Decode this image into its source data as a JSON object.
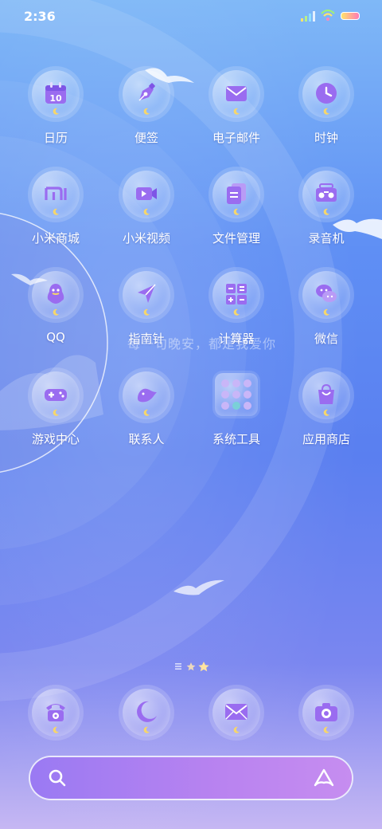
{
  "status": {
    "time": "2:36"
  },
  "apps": [
    {
      "label": "日历",
      "icon": "calendar-icon",
      "calendar_day": "10"
    },
    {
      "label": "便签",
      "icon": "pen-nib-icon"
    },
    {
      "label": "电子邮件",
      "icon": "mail-icon"
    },
    {
      "label": "时钟",
      "icon": "clock-icon"
    },
    {
      "label": "小米商城",
      "icon": "mi-logo-icon"
    },
    {
      "label": "小米视频",
      "icon": "video-icon"
    },
    {
      "label": "文件管理",
      "icon": "files-icon"
    },
    {
      "label": "录音机",
      "icon": "radio-recorder-icon"
    },
    {
      "label": "QQ",
      "icon": "penguin-icon"
    },
    {
      "label": "指南针",
      "icon": "compass-arrow-icon"
    },
    {
      "label": "计算器",
      "icon": "calculator-icon"
    },
    {
      "label": "微信",
      "icon": "chat-bubbles-icon"
    },
    {
      "label": "游戏中心",
      "icon": "gamepad-icon"
    },
    {
      "label": "联系人",
      "icon": "bird-icon"
    },
    {
      "label": "系统工具",
      "icon": "tools-folder-icon"
    },
    {
      "label": "应用商店",
      "icon": "shopping-bag-icon"
    }
  ],
  "motto": "每一句晚安，都是我爱你",
  "dock": [
    {
      "icon": "phone-icon"
    },
    {
      "icon": "moon-icon"
    },
    {
      "icon": "envelope-icon"
    },
    {
      "icon": "camera-icon"
    }
  ],
  "colors": {
    "icon_purple": "#9a6cf0",
    "search_bar": "#a77ff2",
    "accent_moon": "#f6d66b"
  }
}
